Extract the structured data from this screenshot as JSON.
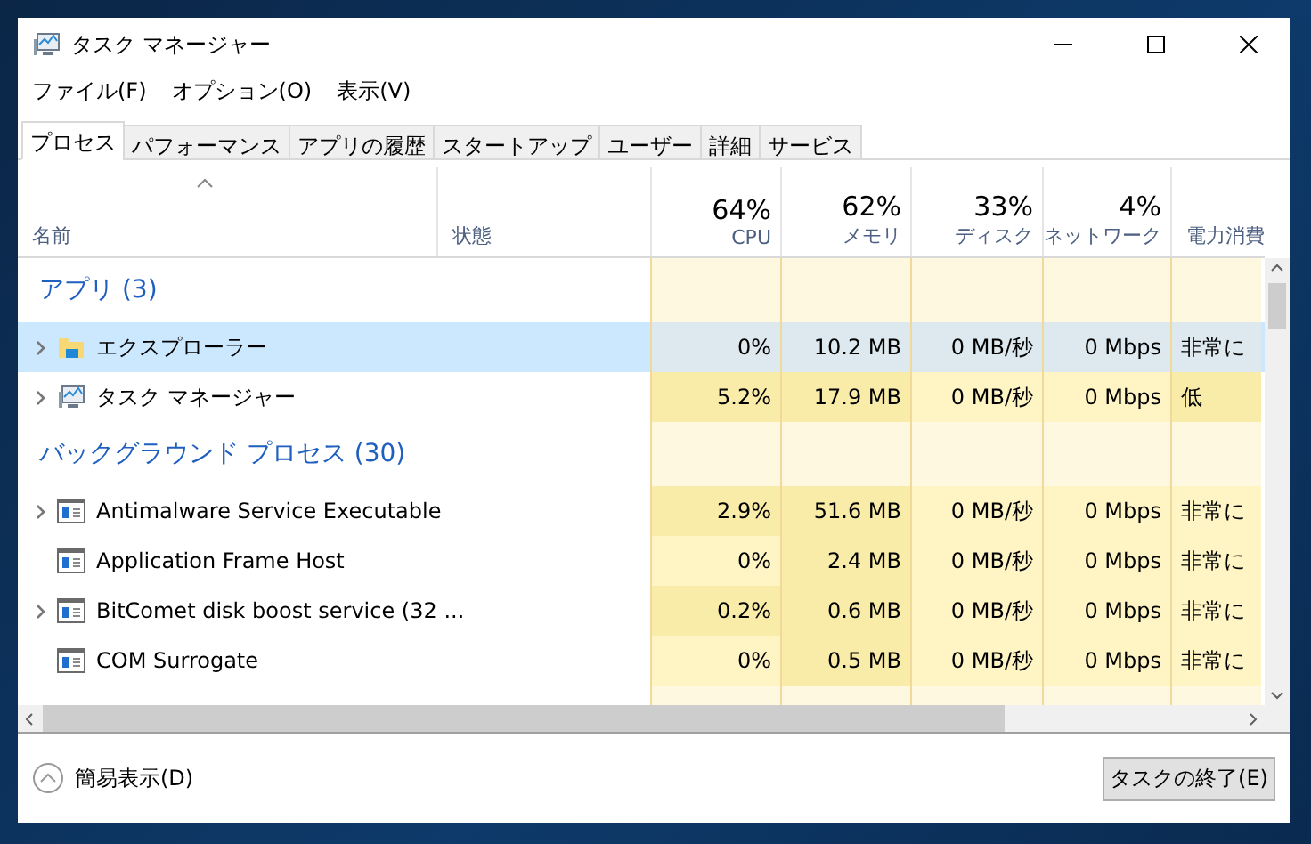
{
  "window": {
    "title": "タスク マネージャー"
  },
  "menu": [
    "ファイル(F)",
    "オプション(O)",
    "表示(V)"
  ],
  "tabs": [
    {
      "label": "プロセス",
      "selected": true
    },
    {
      "label": "パフォーマンス",
      "selected": false
    },
    {
      "label": "アプリの履歴",
      "selected": false
    },
    {
      "label": "スタートアップ",
      "selected": false
    },
    {
      "label": "ユーザー",
      "selected": false
    },
    {
      "label": "詳細",
      "selected": false
    },
    {
      "label": "サービス",
      "selected": false
    }
  ],
  "columns": [
    {
      "label": "名前",
      "kind": "name"
    },
    {
      "label": "状態",
      "kind": "status"
    },
    {
      "label": "CPU",
      "summary": "64%",
      "kind": "metric"
    },
    {
      "label": "メモリ",
      "summary": "62%",
      "kind": "metric"
    },
    {
      "label": "ディスク",
      "summary": "33%",
      "kind": "metric"
    },
    {
      "label": "ネットワーク",
      "summary": "4%",
      "kind": "metric"
    },
    {
      "label": "電力消費",
      "kind": "power"
    }
  ],
  "groups": [
    {
      "title": "アプリ (3)",
      "rows": [
        {
          "name": "エクスプローラー",
          "kind": "folder",
          "expandable": true,
          "selected": true,
          "cells": [
            {
              "text": "0%",
              "color": "#dde9ee"
            },
            {
              "text": "10.2 MB",
              "color": "#dde9ee"
            },
            {
              "text": "0 MB/秒",
              "color": "#dde9ee"
            },
            {
              "text": "0 Mbps",
              "color": "#dde9ee"
            },
            {
              "text": "非常に",
              "color": "#dde9ee"
            }
          ]
        },
        {
          "name": "タスク マネージャー",
          "kind": "monitor",
          "expandable": true,
          "selected": false,
          "cells": [
            {
              "text": "5.2%",
              "color": "#f9eca8"
            },
            {
              "text": "17.9 MB",
              "color": "#f9eca8"
            },
            {
              "text": "0 MB/秒",
              "color": "#fff4c4"
            },
            {
              "text": "0 Mbps",
              "color": "#fff4c4"
            },
            {
              "text": "低",
              "color": "#f9eca8"
            }
          ]
        }
      ]
    },
    {
      "title": "バックグラウンド プロセス (30)",
      "rows": [
        {
          "name": "Antimalware Service Executable",
          "kind": "window",
          "expandable": true,
          "selected": false,
          "cells": [
            {
              "text": "2.9%",
              "color": "#f9eca8"
            },
            {
              "text": "51.6 MB",
              "color": "#f9eca8"
            },
            {
              "text": "0 MB/秒",
              "color": "#fff4c4"
            },
            {
              "text": "0 Mbps",
              "color": "#fff4c4"
            },
            {
              "text": "非常に",
              "color": "#fff4c4"
            }
          ]
        },
        {
          "name": "Application Frame Host",
          "kind": "window",
          "expandable": false,
          "selected": false,
          "cells": [
            {
              "text": "0%",
              "color": "#fff4c4"
            },
            {
              "text": "2.4 MB",
              "color": "#f9eca8"
            },
            {
              "text": "0 MB/秒",
              "color": "#fff4c4"
            },
            {
              "text": "0 Mbps",
              "color": "#fff4c4"
            },
            {
              "text": "非常に",
              "color": "#fff4c4"
            }
          ]
        },
        {
          "name": "BitComet disk boost service (32 ...",
          "kind": "window",
          "expandable": true,
          "selected": false,
          "cells": [
            {
              "text": "0.2%",
              "color": "#f9eca8"
            },
            {
              "text": "0.6 MB",
              "color": "#f9eca8"
            },
            {
              "text": "0 MB/秒",
              "color": "#fff4c4"
            },
            {
              "text": "0 Mbps",
              "color": "#fff4c4"
            },
            {
              "text": "非常に",
              "color": "#fff4c4"
            }
          ]
        },
        {
          "name": "COM Surrogate",
          "kind": "window",
          "expandable": false,
          "selected": false,
          "cells": [
            {
              "text": "0%",
              "color": "#fff4c4"
            },
            {
              "text": "0.5 MB",
              "color": "#f9eca8"
            },
            {
              "text": "0 MB/秒",
              "color": "#fff4c4"
            },
            {
              "text": "0 Mbps",
              "color": "#fff4c4"
            },
            {
              "text": "非常に",
              "color": "#fff4c4"
            }
          ]
        }
      ]
    }
  ],
  "footer": {
    "toggle": "簡易表示(D)",
    "end_task": "タスクの終了(E)"
  }
}
